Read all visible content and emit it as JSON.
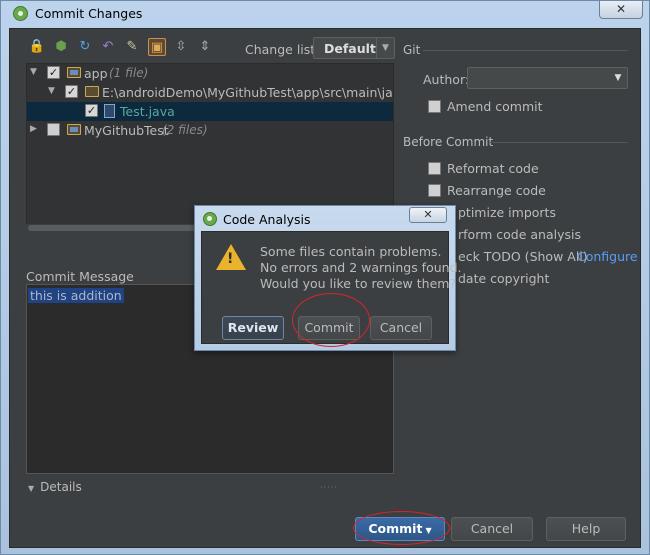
{
  "window": {
    "title": "Commit Changes",
    "close_glyph": "✕"
  },
  "toolbar": {
    "icons": [
      "lock-icon",
      "refresh-icon",
      "sync-icon",
      "undo-icon",
      "diff-icon",
      "group-icon",
      "expand-icon",
      "collapse-icon"
    ],
    "changelist_label": "Change list:",
    "changelist_value": "Default"
  },
  "tree": {
    "rows": [
      {
        "name": "app",
        "count": "(1 file)"
      },
      {
        "name": "E:\\androidDemo\\MyGithubTest\\app\\src\\main\\java\\con"
      },
      {
        "name": "Test.java"
      },
      {
        "name": "MyGithubTest",
        "count": "(2 files)"
      }
    ]
  },
  "commit_message": {
    "label": "Commit Message",
    "text": "this is addition"
  },
  "details_label": "Details",
  "git": {
    "header": "Git",
    "author_label": "Author:",
    "author_value": "",
    "amend_label": "Amend commit"
  },
  "before_commit": {
    "header": "Before Commit",
    "options": [
      "Reformat code",
      "Rearrange code",
      "ptimize imports",
      "rform code analysis",
      "eck TODO (Show All)",
      "date copyright"
    ],
    "configure_link": "Configure"
  },
  "buttons": {
    "commit": "Commit",
    "cancel": "Cancel",
    "help": "Help"
  },
  "dialog": {
    "title": "Code Analysis",
    "close_glyph": "✕",
    "lines": [
      "Some files contain problems.",
      "No errors and 2 warnings found.",
      "Would you like to review them?"
    ],
    "review": "Review",
    "commit": "Commit",
    "cancel": "Cancel"
  },
  "colors": {
    "accent": "#589df6",
    "highlight": "#214283",
    "annotation": "#d4262b",
    "warning": "#e9b32b"
  }
}
